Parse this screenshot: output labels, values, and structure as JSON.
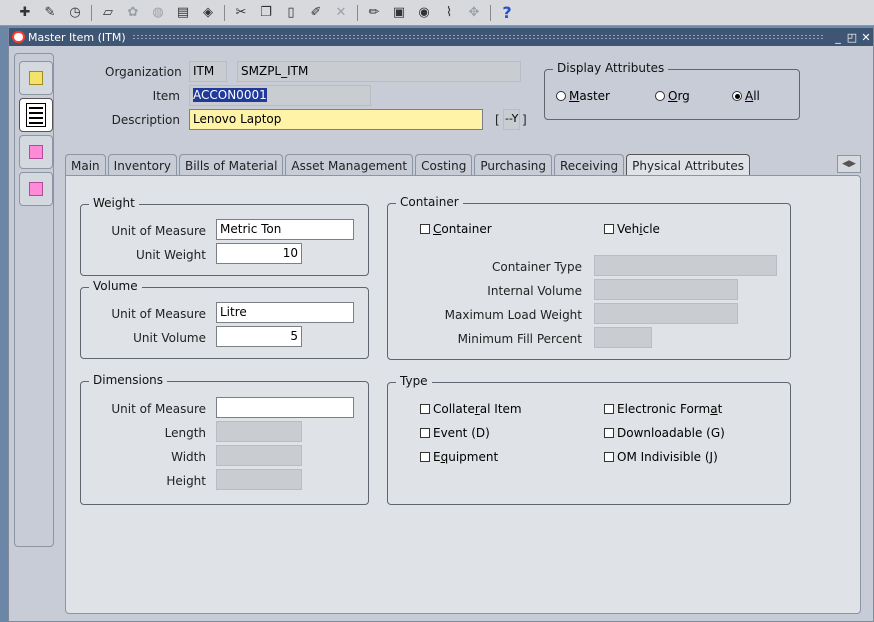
{
  "toolbar": {
    "icons": [
      "new-icon",
      "find-icon",
      "navigator-icon",
      "folder-icon",
      "save-icon",
      "next-step-icon",
      "print-icon",
      "close-form-icon",
      "cut-icon",
      "copy-icon",
      "paste-icon",
      "clear-record-icon",
      "delete-icon",
      "edit-field-icon",
      "zoom-icon",
      "translations-icon",
      "attachments-icon",
      "folder-tools-icon",
      "help-icon"
    ],
    "help_glyph": "?"
  },
  "window": {
    "title": "Master Item (ITM)"
  },
  "header": {
    "organization_label": "Organization",
    "organization_code": "ITM",
    "organization_name": "SMZPL_ITM",
    "item_label": "Item",
    "item_value": "ACCON0001",
    "description_label": "Description",
    "description_value": "Lenovo Laptop",
    "flex_bracket_left": "[",
    "flex_value": "--Y",
    "flex_bracket_right": "]"
  },
  "display_attributes": {
    "title": "Display Attributes",
    "options": [
      {
        "label": "Master",
        "underline": "M",
        "rest": "aster",
        "selected": false
      },
      {
        "label": "Org",
        "underline": "O",
        "rest": "rg",
        "selected": false
      },
      {
        "label": "All",
        "underline": "A",
        "rest": "ll",
        "selected": true
      }
    ]
  },
  "tabs": [
    {
      "label": "Main",
      "active": false
    },
    {
      "label": "Inventory",
      "active": false
    },
    {
      "label": "Bills of Material",
      "active": false
    },
    {
      "label": "Asset Management",
      "active": false
    },
    {
      "label": "Costing",
      "active": false
    },
    {
      "label": "Purchasing",
      "active": false
    },
    {
      "label": "Receiving",
      "active": false
    },
    {
      "label": "Physical Attributes",
      "active": true
    }
  ],
  "weight": {
    "title": "Weight",
    "uom_label": "Unit of Measure",
    "uom_value": "Metric Ton",
    "unit_label": "Unit Weight",
    "unit_value": "10"
  },
  "volume": {
    "title": "Volume",
    "uom_label": "Unit of Measure",
    "uom_value": "Litre",
    "unit_label": "Unit Volume",
    "unit_value": "5"
  },
  "dimensions": {
    "title": "Dimensions",
    "uom_label": "Unit of Measure",
    "uom_value": "",
    "length_label": "Length",
    "width_label": "Width",
    "height_label": "Height"
  },
  "container": {
    "title": "Container",
    "container_pre": "",
    "container_u": "C",
    "container_post": "ontainer",
    "vehicle_pre": "Veh",
    "vehicle_u": "i",
    "vehicle_post": "cle",
    "container_type_label": "Container Type",
    "internal_volume_label": "Internal Volume",
    "max_load_label": "Maximum Load Weight",
    "min_fill_label": "Minimum Fill Percent"
  },
  "type": {
    "title": "Type",
    "collateral_pre": "Collate",
    "collateral_u": "r",
    "collateral_post": "al Item",
    "event": "Event (D)",
    "equipment_pre": "E",
    "equipment_u": "q",
    "equipment_post": "uipment",
    "electronic_pre": "Electronic Form",
    "electronic_u": "a",
    "electronic_post": "t",
    "downloadable": "Downloadable (G)",
    "om_indivisible": "OM Indivisible (J)"
  }
}
